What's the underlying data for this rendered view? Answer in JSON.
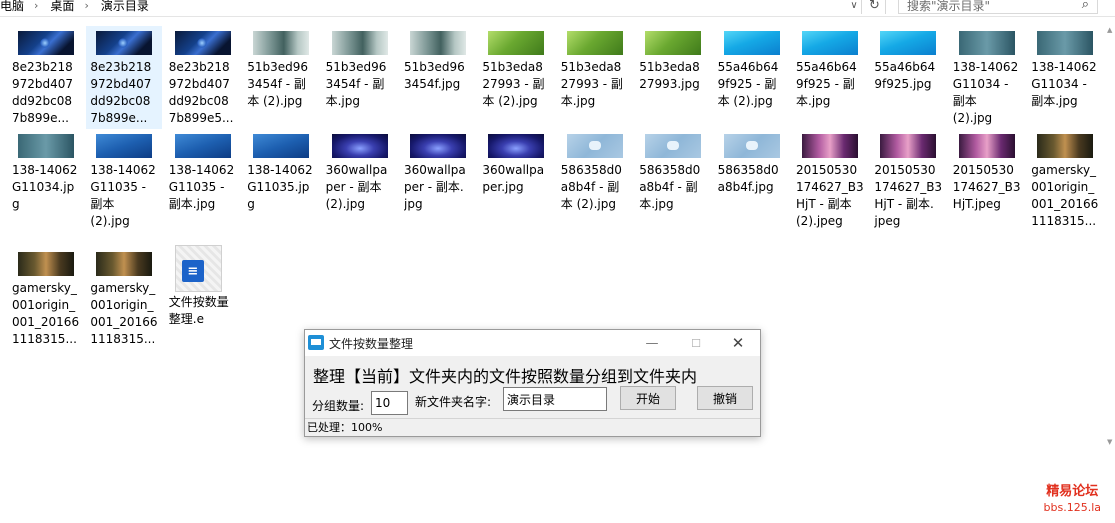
{
  "address": {
    "crumbs": [
      "电脑",
      "桌面",
      "演示目录"
    ],
    "search_placeholder": "搜索\"演示目录\""
  },
  "icons": {
    "dropdown": "chevron-down-icon",
    "refresh": "refresh-icon",
    "search": "search-icon"
  },
  "files": [
    {
      "name": "8e23b218972bd40 7dd92bc087b899e...",
      "label": "8e23b218\n972bd407\ndd92bc08\n7b899e...",
      "thumb": "space"
    },
    {
      "name": "8e23b218972bd407dd92bc087b899e...",
      "label": "8e23b218\n972bd407\ndd92bc08\n7b899e...",
      "thumb": "space",
      "selected": true
    },
    {
      "name": "8e23b218972bd407dd92bc087b899e5...",
      "label": "8e23b218\n972bd407\ndd92bc08\n7b899e5...",
      "thumb": "space"
    },
    {
      "name": "51b3ed963454f - 副本 (2).jpg",
      "label": "51b3ed96\n3454f - 副\n本 (2).jpg",
      "thumb": "city"
    },
    {
      "name": "51b3ed963454f - 副本.jpg",
      "label": "51b3ed96\n3454f - 副\n本.jpg",
      "thumb": "city"
    },
    {
      "name": "51b3ed963454f.jpg",
      "label": "51b3ed96\n3454f.jpg",
      "thumb": "city"
    },
    {
      "name": "51b3eda827993 - 副本 (2).jpg",
      "label": "51b3eda8\n27993 - 副\n本 (2).jpg",
      "thumb": "green"
    },
    {
      "name": "51b3eda827993 - 副本.jpg",
      "label": "51b3eda8\n27993 - 副\n本.jpg",
      "thumb": "green"
    },
    {
      "name": "51b3eda827993.jpg",
      "label": "51b3eda8\n27993.jpg",
      "thumb": "green"
    },
    {
      "name": "55a46b649f925 - 副本 (2).jpg",
      "label": "55a46b64\n9f925 - 副\n本 (2).jpg",
      "thumb": "blue"
    },
    {
      "name": "55a46b649f925 - 副本.jpg",
      "label": "55a46b64\n9f925 - 副\n本.jpg",
      "thumb": "blue"
    },
    {
      "name": "55a46b649f925.jpg",
      "label": "55a46b64\n9f925.jpg",
      "thumb": "blue"
    },
    {
      "name": "138-14062G11034 - 副本 (2).jpg",
      "label": "138-14062\nG11034 -\n副本\n(2).jpg",
      "thumb": "teal"
    },
    {
      "name": "138-14062G11034 - 副本.jpg",
      "label": "138-14062\nG11034 -\n副本.jpg",
      "thumb": "teal"
    },
    {
      "name": "138-14062G11034.jpg",
      "label": "138-14062\nG11034.jp\ng",
      "thumb": "teal"
    },
    {
      "name": "138-14062G11035 - 副本 (2).jpg",
      "label": "138-14062\nG11035 -\n副本\n(2).jpg",
      "thumb": "navy"
    },
    {
      "name": "138-14062G11035 - 副本.jpg",
      "label": "138-14062\nG11035 -\n副本.jpg",
      "thumb": "navy"
    },
    {
      "name": "138-14062G11035.jpg",
      "label": "138-14062\nG11035.jp\ng",
      "thumb": "navy"
    },
    {
      "name": "360wallpaper - 副本 (2).jpg",
      "label": "360wallpa\nper - 副本\n(2).jpg",
      "thumb": "mac"
    },
    {
      "name": "360wallpaper - 副本.jpg",
      "label": "360wallpa\nper - 副本.\njpg",
      "thumb": "mac"
    },
    {
      "name": "360wallpaper.jpg",
      "label": "360wallpa\nper.jpg",
      "thumb": "mac"
    },
    {
      "name": "586358d0a8b4f - 副本 (2).jpg",
      "label": "586358d0\na8b4f - 副\n本 (2).jpg",
      "thumb": "ice"
    },
    {
      "name": "586358d0a8b4f - 副本.jpg",
      "label": "586358d0\na8b4f - 副\n本.jpg",
      "thumb": "ice"
    },
    {
      "name": "586358d0a8b4f.jpg",
      "label": "586358d0\na8b4f.jpg",
      "thumb": "ice"
    },
    {
      "name": "20150530174627_B3HjT - 副本 (2).jpeg",
      "label": "20150530\n174627_B3\nHjT - 副本\n(2).jpeg",
      "thumb": "anime"
    },
    {
      "name": "20150530174627_B3HjT - 副本.jpeg",
      "label": "20150530\n174627_B3\nHjT - 副本.\njpeg",
      "thumb": "anime"
    },
    {
      "name": "20150530174627_B3HjT.jpeg",
      "label": "20150530\n174627_B3\nHjT.jpeg",
      "thumb": "anime"
    },
    {
      "name": "gamersky_001origin_001_20166111 8315...",
      "label": "gamersky_\n001origin_\n001_20166\n1118315...",
      "thumb": "game"
    },
    {
      "name": "gamersky_001origin_001_201661118315...",
      "label": "gamersky_\n001origin_\n001_20166\n1118315...",
      "thumb": "game"
    },
    {
      "name": "gamersky_001origin_001_201661118315...",
      "label": "gamersky_\n001origin_\n001_20166\n1118315...",
      "thumb": "game"
    },
    {
      "name": "文件按数量整理.e",
      "label": "文件按数量\n整理.e",
      "thumb": "exe"
    }
  ],
  "dialog": {
    "title": "文件按数量整理",
    "headline": "整理【当前】文件夹内的文件按照数量分组到文件夹内",
    "count_label": "分组数量:",
    "count_value": "10",
    "folder_label": "新文件夹名字:",
    "folder_value": "演示目录",
    "start_label": "开始",
    "cancel_label": "撤销",
    "status": "已处理：100%",
    "min_glyph": "—",
    "max_glyph": "☐",
    "close_glyph": "✕"
  },
  "watermark": {
    "line1": "精易论坛",
    "line2": "bbs.125.la"
  }
}
